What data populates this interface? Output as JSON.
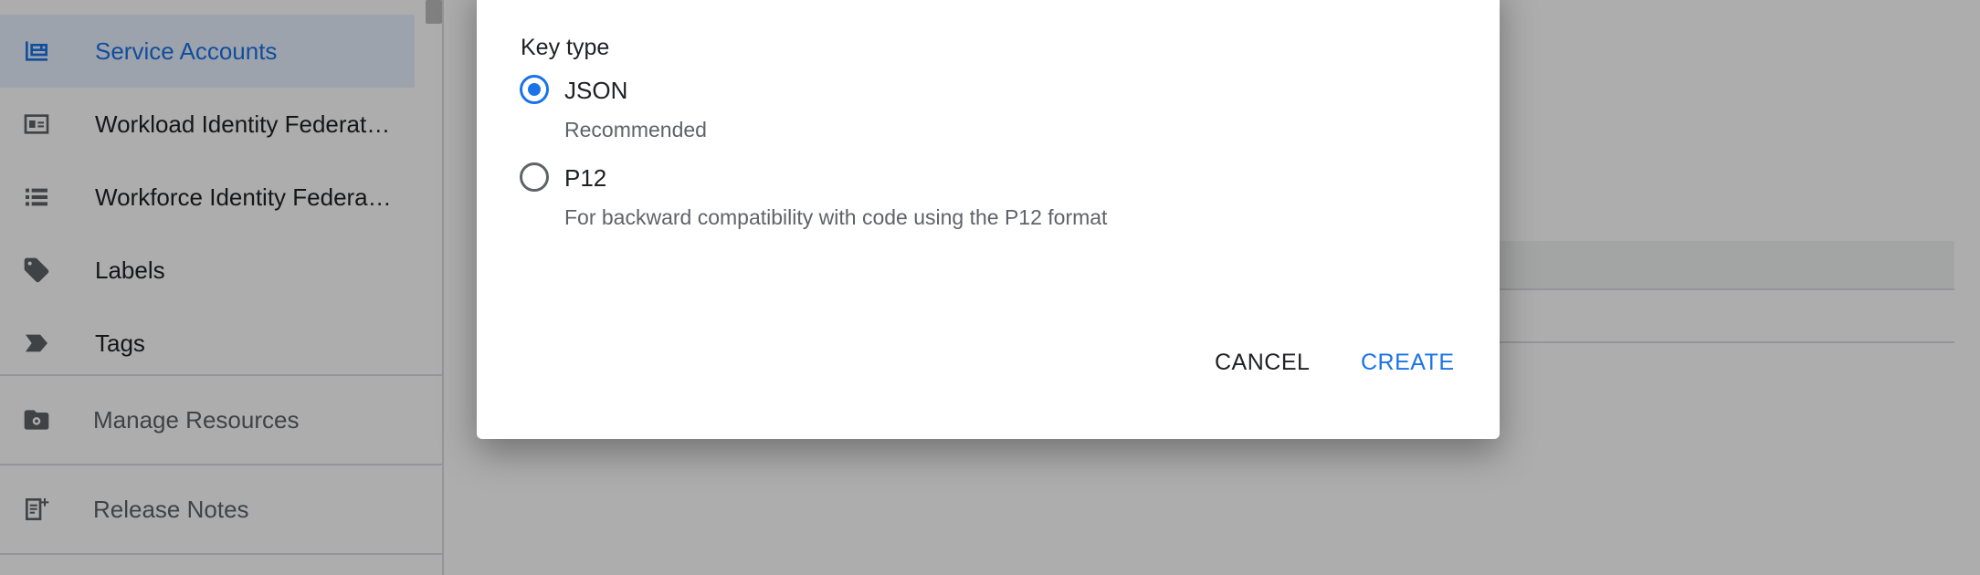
{
  "sidebar": {
    "items": [
      {
        "label": "Service Accounts",
        "icon": "service-account-icon",
        "active": true
      },
      {
        "label": "Workload Identity Federat…",
        "icon": "id-card-icon"
      },
      {
        "label": "Workforce Identity Federa…",
        "icon": "list-icon"
      },
      {
        "label": "Labels",
        "icon": "label-tag-icon"
      },
      {
        "label": "Tags",
        "icon": "tag-arrow-icon"
      }
    ],
    "manage_resources": {
      "label": "Manage Resources",
      "icon": "folder-gear-icon"
    },
    "release_notes": {
      "label": "Release Notes",
      "icon": "release-notes-icon"
    }
  },
  "dialog": {
    "section_title": "Key type",
    "options": [
      {
        "label": "JSON",
        "description": "Recommended",
        "selected": true
      },
      {
        "label": "P12",
        "description": "For backward compatibility with code using the P12 format",
        "selected": false
      }
    ],
    "cancel_label": "CANCEL",
    "create_label": "CREATE"
  },
  "colors": {
    "accent": "#1a73e8",
    "scrim": "rgba(0,0,0,0.32)",
    "active_bg": "#e8f0fe"
  }
}
